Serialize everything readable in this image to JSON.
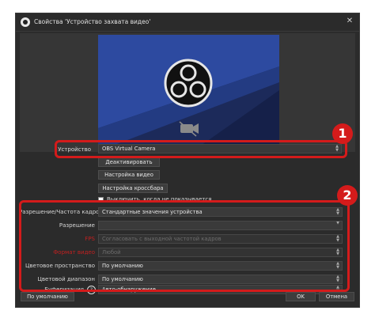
{
  "window": {
    "title": "Свойства 'Устройство захвата видео'",
    "close_glyph": "✕"
  },
  "device": {
    "label": "Устройство",
    "value": "OBS Virtual Camera"
  },
  "buttons": {
    "deactivate": "Деактивировать",
    "video_settings": "Настройка видео",
    "crossbar_settings": "Настройка кроссбара",
    "defaults": "По умолчанию",
    "ok": "OK",
    "cancel": "Отмена"
  },
  "checkbox_label": "Выключить, когда не показывается",
  "props": [
    {
      "label": "Разрешение/Частота кадров",
      "value": "Стандартные значения устройства",
      "red": false,
      "dim": false
    },
    {
      "label": "Разрешение",
      "value": "",
      "red": false,
      "dim": false
    },
    {
      "label": "FPS",
      "value": "Согласовать с выходной частотой кадров",
      "red": true,
      "dim": true
    },
    {
      "label": "Формат видео",
      "value": "Любой",
      "red": true,
      "dim": true
    },
    {
      "label": "Цветовое пространство",
      "value": "По умолчанию",
      "red": false,
      "dim": false
    },
    {
      "label": "Цветовой диапазон",
      "value": "По умолчанию",
      "red": false,
      "dim": false
    },
    {
      "label": "Буферизация",
      "value": "Авто-обнаружение",
      "red": false,
      "dim": false
    }
  ],
  "buffer_help_glyph": "?",
  "callouts": [
    "1",
    "2"
  ],
  "colors": {
    "accent": "#d41b1b",
    "window_bg": "#2b2b2b"
  },
  "icons": [
    "obs-logo-icon",
    "camera-off-icon",
    "close-icon",
    "help-icon"
  ]
}
